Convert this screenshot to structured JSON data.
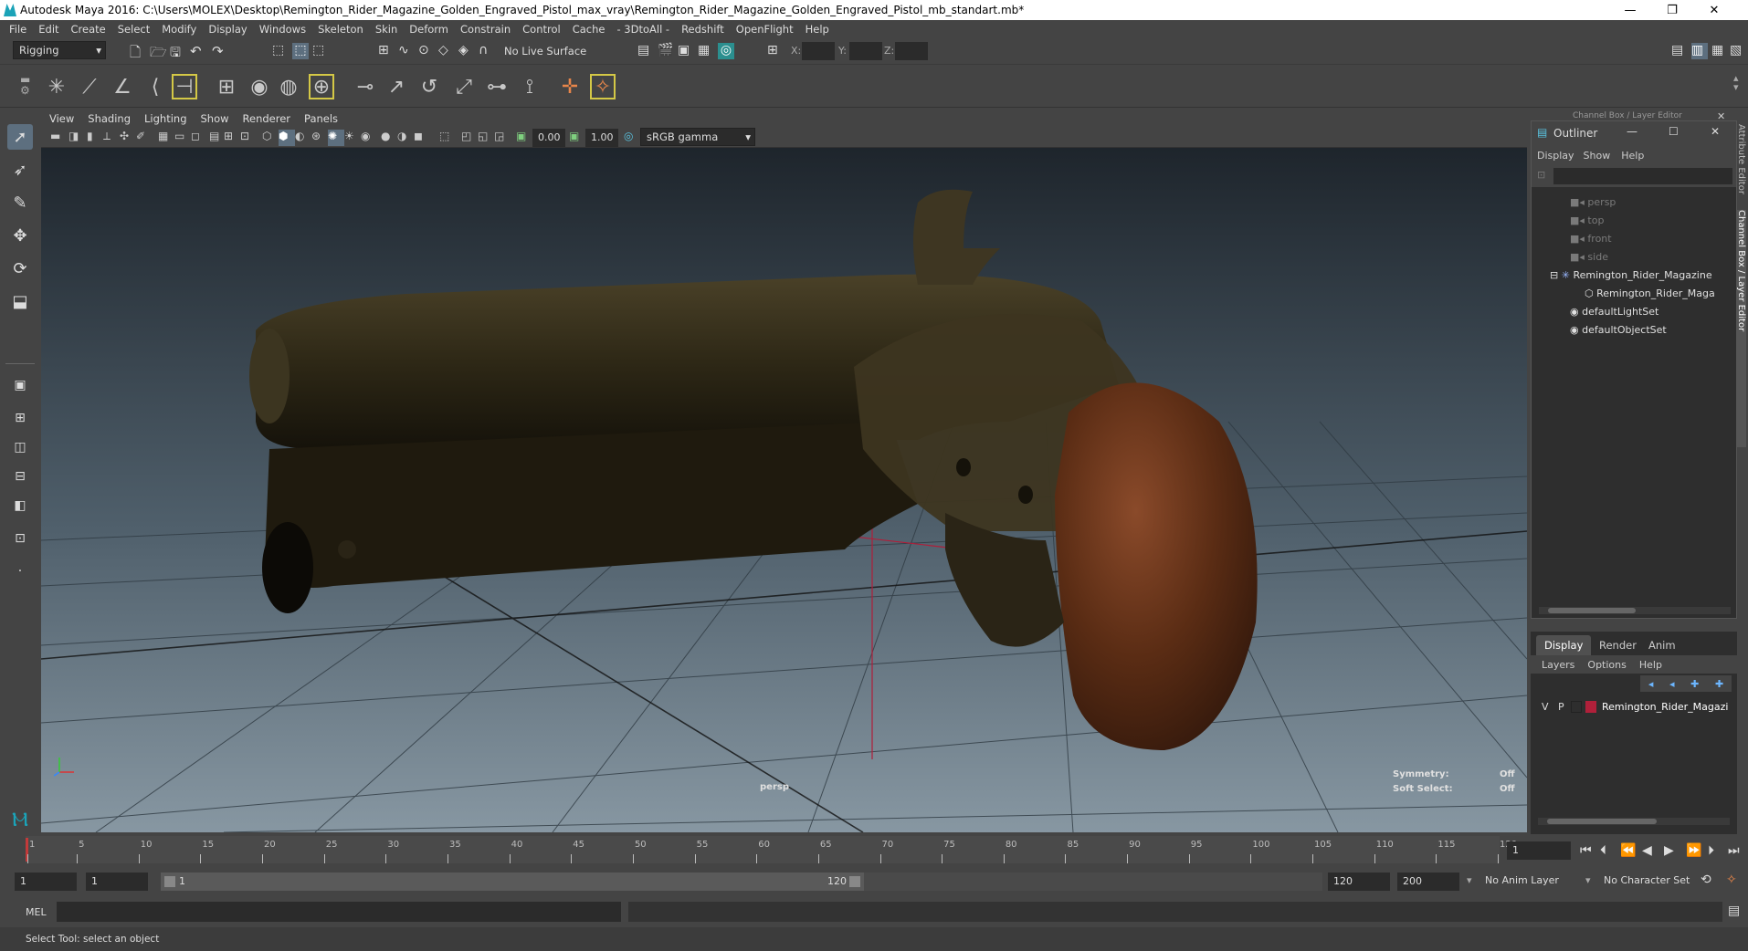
{
  "window": {
    "title": "Autodesk Maya 2016: C:\\Users\\MOLEX\\Desktop\\Remington_Rider_Magazine_Golden_Engraved_Pistol_max_vray\\Remington_Rider_Magazine_Golden_Engraved_Pistol_mb_standart.mb*",
    "minimize": "—",
    "restore": "❐",
    "close": "✕"
  },
  "menubar": [
    "File",
    "Edit",
    "Create",
    "Select",
    "Modify",
    "Display",
    "Windows",
    "Skeleton",
    "Skin",
    "Deform",
    "Constrain",
    "Control",
    "Cache",
    "- 3DtoAll -",
    "Redshift",
    "OpenFlight",
    "Help"
  ],
  "statusline": {
    "menuset": "Rigging",
    "live_surface": "No Live Surface",
    "x_label": "X:",
    "y_label": "Y:",
    "z_label": "Z:"
  },
  "viewport": {
    "menu": [
      "View",
      "Shading",
      "Lighting",
      "Show",
      "Renderer",
      "Panels"
    ],
    "exposure": "0.00",
    "gamma": "1.00",
    "color_space": "sRGB gamma",
    "camera_label": "persp",
    "symmetry_label": "Symmetry:",
    "symmetry_value": "Off",
    "soft_select_label": "Soft Select:",
    "soft_select_value": "Off"
  },
  "channelbox_header": "Channel Box / Layer Editor",
  "side_tabs": {
    "attribute_editor": "Attribute Editor",
    "channel_box": "Channel Box / Layer Editor"
  },
  "outliner": {
    "title": "Outliner",
    "menu": [
      "Display",
      "Show",
      "Help"
    ],
    "items": [
      {
        "label": "persp",
        "kind": "camera"
      },
      {
        "label": "top",
        "kind": "camera"
      },
      {
        "label": "front",
        "kind": "camera"
      },
      {
        "label": "side",
        "kind": "camera"
      },
      {
        "label": "Remington_Rider_Magazine",
        "kind": "group"
      },
      {
        "label": "Remington_Rider_Maga",
        "kind": "mesh"
      },
      {
        "label": "defaultLightSet",
        "kind": "set"
      },
      {
        "label": "defaultObjectSet",
        "kind": "set"
      }
    ]
  },
  "layer_editor": {
    "tabs": [
      "Display",
      "Render",
      "Anim"
    ],
    "menu": [
      "Layers",
      "Options",
      "Help"
    ],
    "layer": {
      "v": "V",
      "p": "P",
      "name": "Remington_Rider_Magazi",
      "color": "#b0203a"
    }
  },
  "timeline": {
    "ticks": [
      "1",
      "5",
      "10",
      "15",
      "20",
      "25",
      "30",
      "35",
      "40",
      "45",
      "50",
      "55",
      "60",
      "65",
      "70",
      "75",
      "80",
      "85",
      "90",
      "95",
      "100",
      "105",
      "110",
      "115",
      "120"
    ],
    "current_frame": "1"
  },
  "range": {
    "start": "1",
    "playback_start": "1",
    "slider_start": "1",
    "slider_end": "120",
    "playback_end": "120",
    "end": "200",
    "anim_layer": "No Anim Layer",
    "character_set": "No Character Set"
  },
  "cmdline": {
    "label": "MEL"
  },
  "helpline": {
    "text": "Select Tool: select an object"
  },
  "colors": {
    "accent": "#5d6f7f",
    "timeline_marker": "#c23a3a"
  }
}
